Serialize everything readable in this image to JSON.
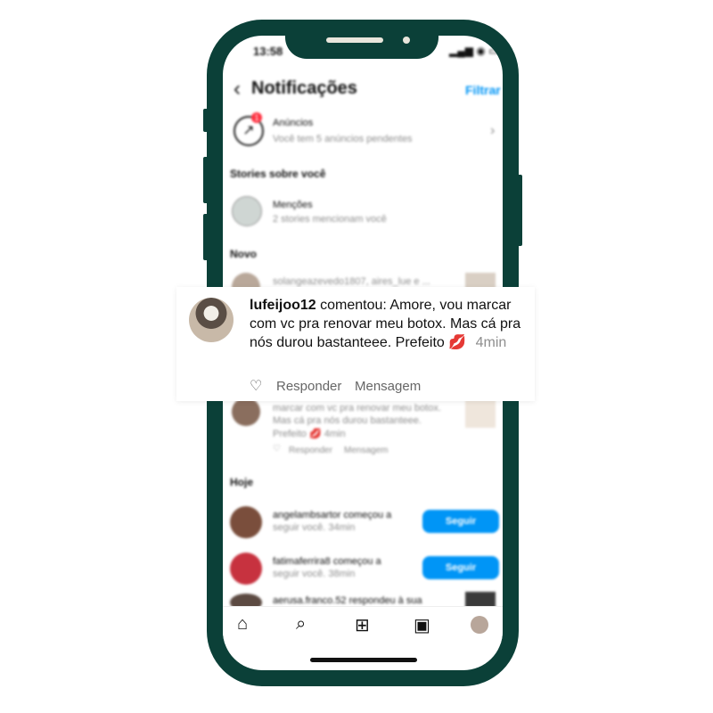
{
  "status": {
    "time": "13:58",
    "icons": "▂▄▆ ◉ ▭"
  },
  "header": {
    "title": "Notificações",
    "filter": "Filtrar"
  },
  "ads": {
    "badge": "1",
    "title": "Anúncios",
    "subtitle": "Você tem 5 anúncios pendentes"
  },
  "stories_section": "Stories sobre você",
  "mentions": {
    "title": "Menções",
    "subtitle": "2 stories mencionam você"
  },
  "new_section": "Novo",
  "blurred_top": "solangeazevedo1807, aires_lue e ...",
  "blurred_comment": {
    "lines": [
      "marcar com vc pra renovar meu botox.",
      "Mas cá pra nós durou bastanteee.",
      "Prefeito 💋 4min"
    ],
    "reply": "Responder",
    "message": "Mensagem"
  },
  "today_section": "Hoje",
  "today_items": [
    {
      "line1": "angelambsartor começou a",
      "line2": "seguir você. 34min",
      "button": "Seguir"
    },
    {
      "line1": "fatimaferrira8 começou a",
      "line2": "seguir você. 38min",
      "button": "Seguir"
    },
    {
      "line1": "aerusa.franco.52 respondeu à sua"
    }
  ],
  "popup": {
    "username": "lufeijoo12",
    "text": "comentou: Amore, vou marcar com vc pra renovar meu botox. Mas cá pra nós durou bastanteee. Prefeito 💋",
    "time": "4min",
    "heart_icon": "♡",
    "reply": "Responder",
    "message": "Mensagem"
  },
  "nav_icons": [
    "home-icon",
    "search-icon",
    "add-icon",
    "reels-icon",
    "profile-icon"
  ]
}
